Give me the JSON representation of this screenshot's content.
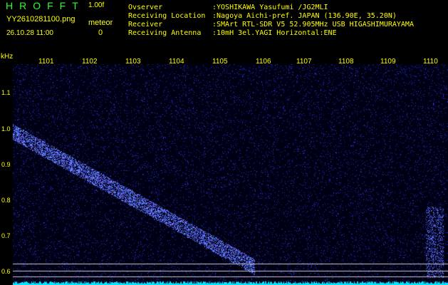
{
  "header": {
    "logo": "HROFFT",
    "version": "1.00f",
    "filename": "YY2610281100.png",
    "datetime": "26.10.28 11:00",
    "meteor_label": "meteor",
    "meteor_count": "0"
  },
  "info": [
    {
      "label": "Ovserver",
      "value": ":YOSHIKAWA Yasufumi /JG2MLI"
    },
    {
      "label": "Receiving Location",
      "value": ":Nagoya Aichi-pref. JAPAN (136.90E, 35.20N)"
    },
    {
      "label": "Receiver",
      "value": ":SMArt RTL-SDR V5 52.905MHz USB HIGASHIMURAYAMA"
    },
    {
      "label": "Receiving Antenna",
      "value": ":10mH 3el.YAGI Horizontal:ENE"
    }
  ],
  "axes": {
    "y_unit": "kHz",
    "y_ticks": [
      "1.1",
      "1.0",
      "0.9",
      "0.8",
      "0.7",
      "0.6"
    ],
    "x_ticks": [
      "1101",
      "1102",
      "1103",
      "1104",
      "1105",
      "1106",
      "1107",
      "1108",
      "1109",
      "1110"
    ]
  },
  "colors": {
    "background": "#000000",
    "text": "#ffff00",
    "logo": "#2cff2c",
    "noise": "#2a35c8",
    "baseline": "#00e5ff",
    "marker_line": "#c8c8c8"
  }
}
